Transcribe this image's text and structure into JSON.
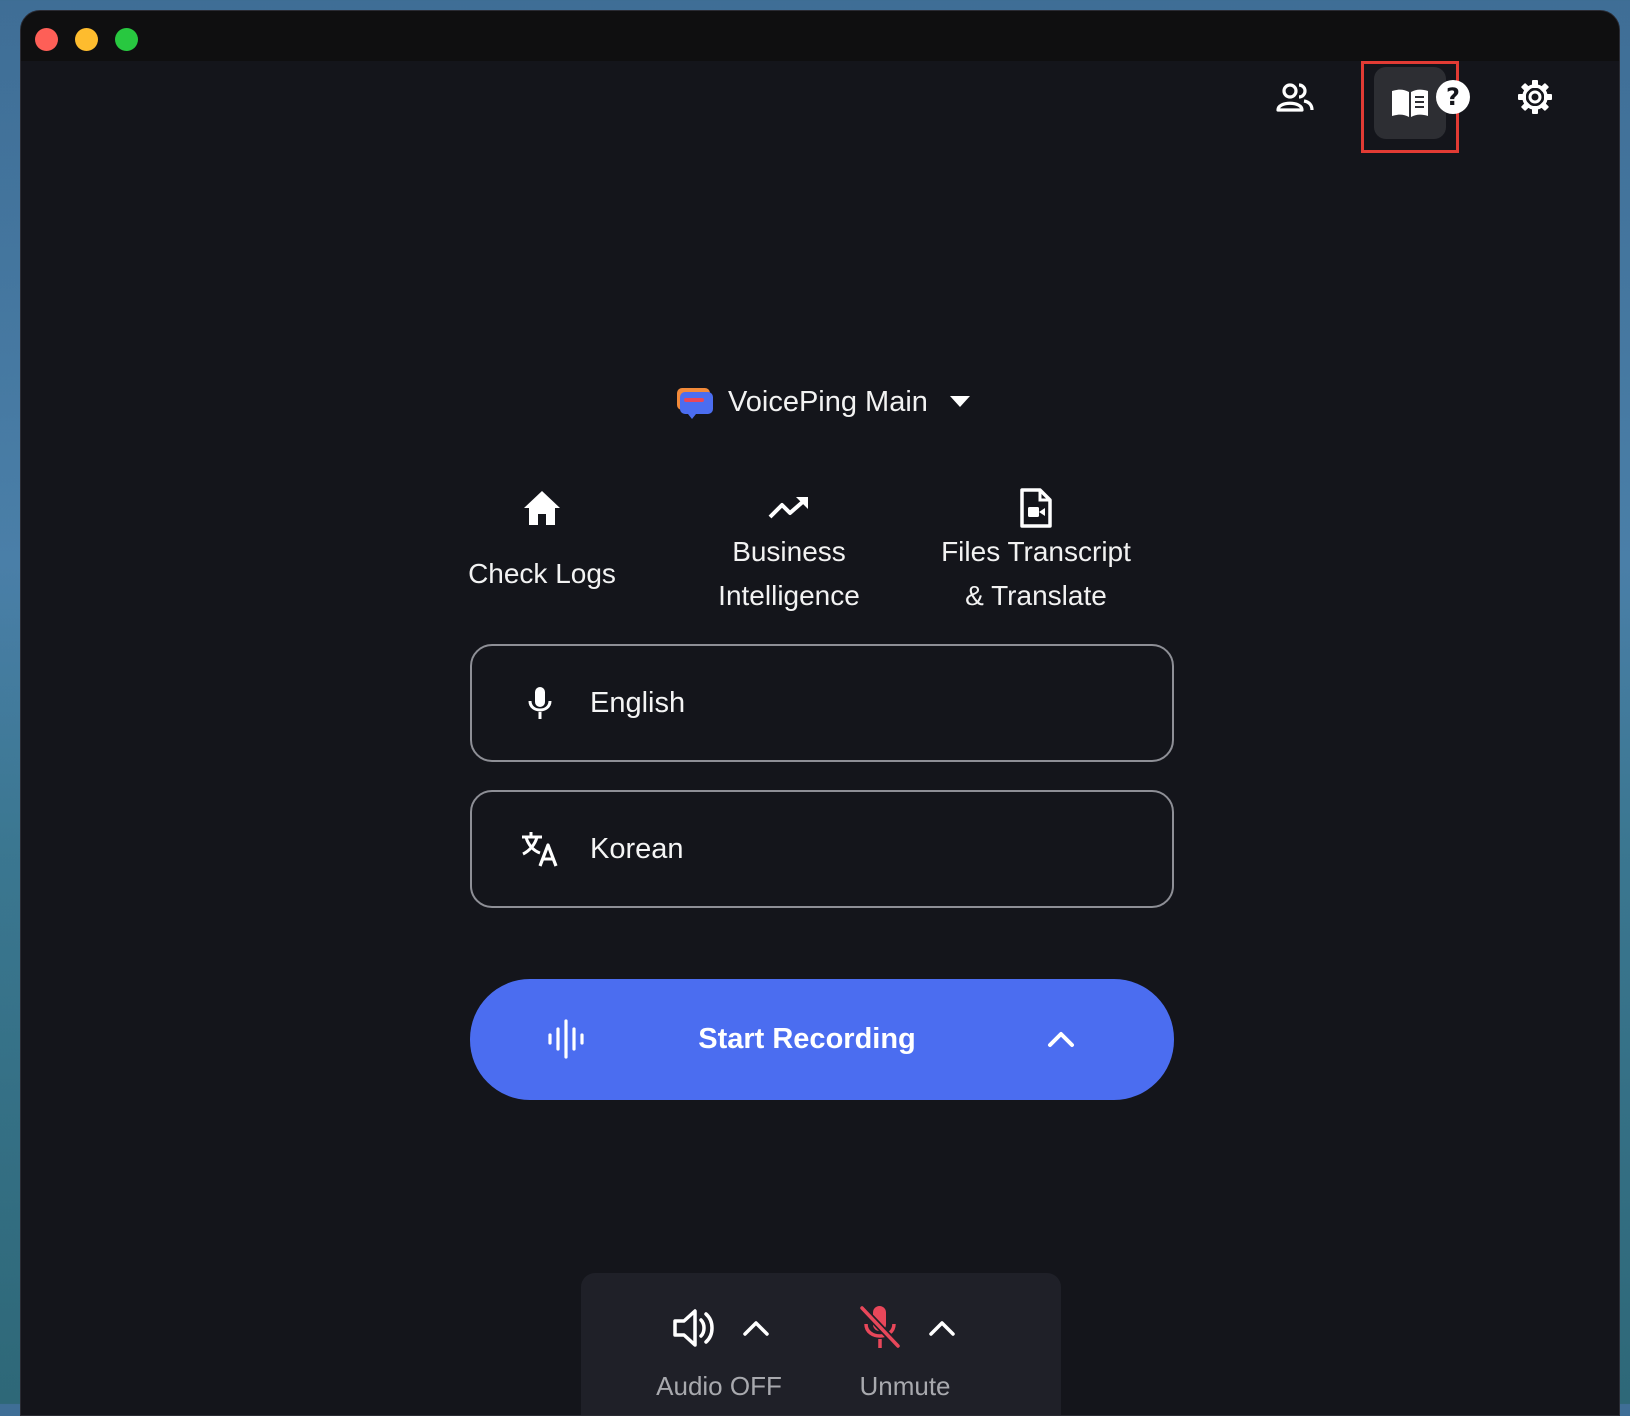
{
  "window": {
    "controls": [
      "close",
      "minimize",
      "zoom"
    ]
  },
  "toolbar": {
    "icons": [
      "people-icon",
      "book-icon",
      "help-icon",
      "settings-icon"
    ],
    "active_icon": "book-icon"
  },
  "workspace": {
    "name": "VoicePing Main",
    "icon": "voiceping-logo"
  },
  "nav": [
    {
      "icon": "home-icon",
      "label": "Check Logs"
    },
    {
      "icon": "trending-up-icon",
      "label_line1": "Business",
      "label_line2": "Intelligence"
    },
    {
      "icon": "file-video-icon",
      "label_line1": "Files Transcript",
      "label_line2": "& Translate"
    }
  ],
  "source_language": {
    "icon": "microphone-icon",
    "value": "English"
  },
  "target_language": {
    "icon": "translate-icon",
    "value": "Korean"
  },
  "record_button": {
    "label": "Start Recording",
    "icon": "waveform-icon"
  },
  "controls": {
    "audio": {
      "label": "Audio OFF",
      "icon": "speaker-icon"
    },
    "mic": {
      "label": "Unmute",
      "icon": "mic-off-icon"
    }
  },
  "colors": {
    "window_bg": "#14151b",
    "accent": "#4b6df0",
    "mic_off": "#e8475a",
    "highlight": "#e23b34"
  }
}
